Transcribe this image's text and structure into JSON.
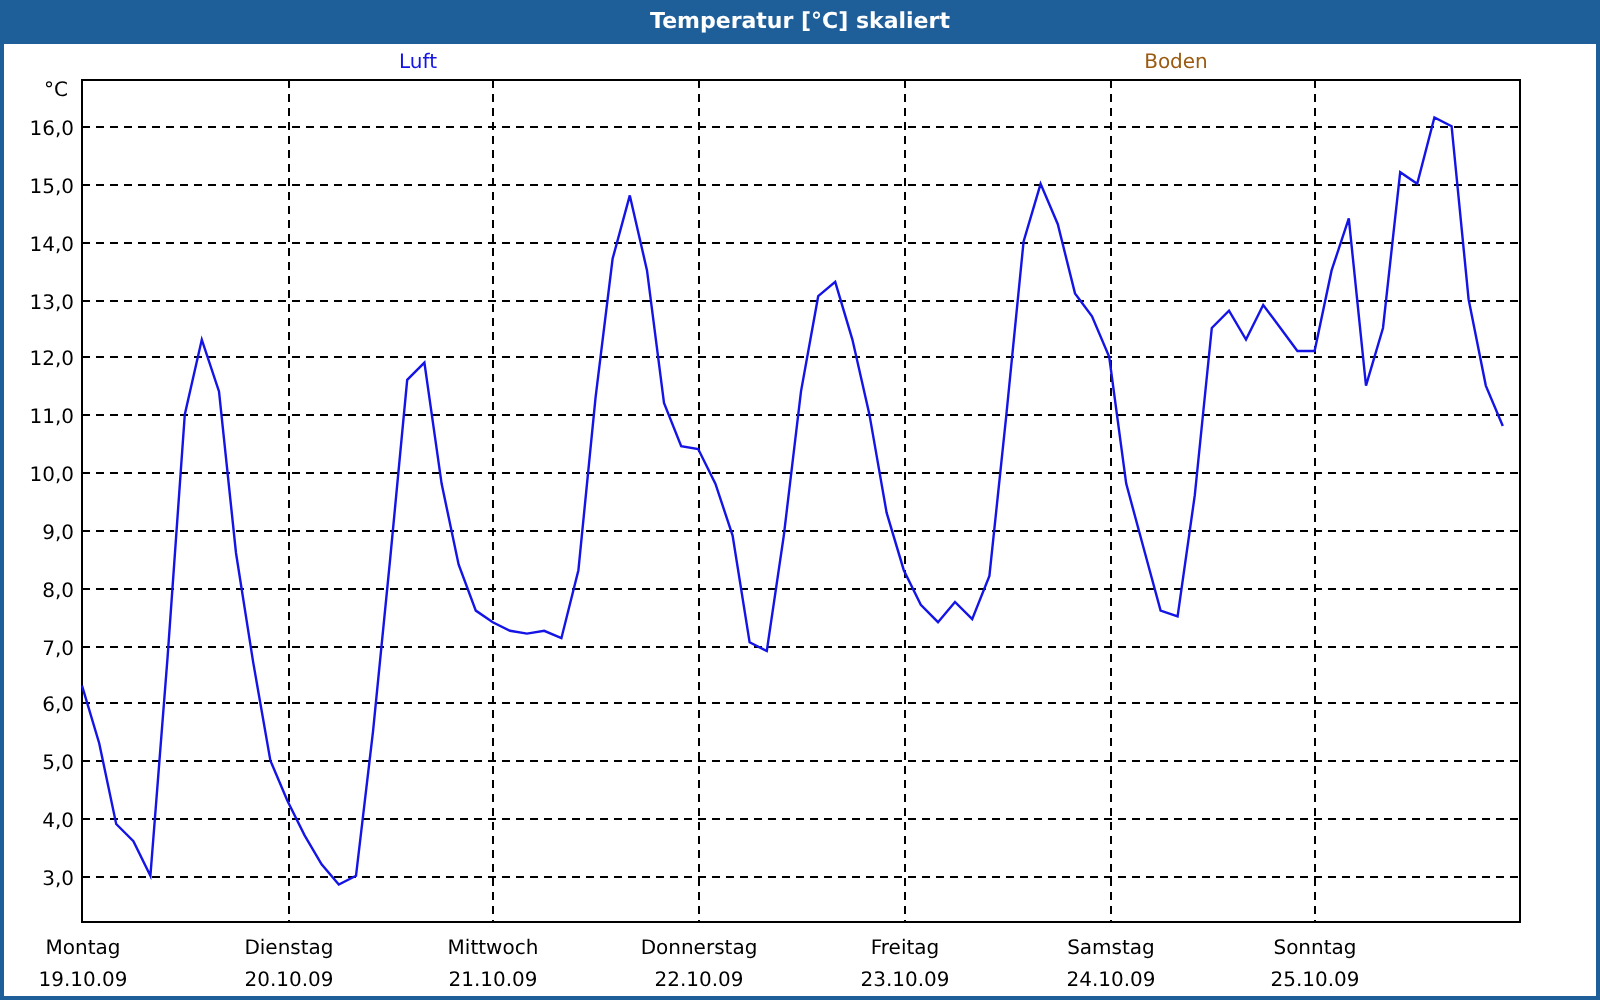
{
  "window": {
    "title": "Temperatur [°C] skaliert"
  },
  "legend": [
    {
      "label": "Boden",
      "color": "#9a5a10"
    }
  ],
  "chart_data": {
    "type": "line",
    "ylabel": "°C",
    "grid": true,
    "categories": [
      "Montag 19.10.09",
      null,
      null,
      null,
      null,
      null,
      null,
      null,
      null,
      null,
      null,
      null,
      "Dienstag 20.10.09",
      null,
      null,
      null,
      null,
      null,
      null,
      null,
      null,
      null,
      null,
      null,
      "Mittwoch 21.10.09",
      null,
      null,
      null,
      null,
      null,
      null,
      null,
      null,
      null,
      null,
      null,
      "Donnerstag 22.10.09",
      null,
      null,
      null,
      null,
      null,
      null,
      null,
      null,
      null,
      null,
      null,
      "Freitag 23.10.09",
      null,
      null,
      null,
      null,
      null,
      null,
      null,
      null,
      null,
      null,
      null,
      "Samstag 24.10.09",
      null,
      null,
      null,
      null,
      null,
      null,
      null,
      null,
      null,
      null,
      null,
      "Sonntag 25.10.09",
      null,
      null,
      null,
      null,
      null,
      null,
      null,
      null,
      null,
      null,
      null
    ],
    "series": [
      {
        "name": "Luft",
        "color": "#1414e6",
        "values": [
          6.3,
          5.3,
          3.9,
          3.6,
          3.0,
          6.8,
          11.0,
          12.3,
          11.4,
          8.6,
          6.7,
          5.0,
          4.3,
          3.7,
          3.2,
          2.85,
          3.0,
          5.5,
          8.5,
          11.6,
          11.9,
          9.8,
          8.4,
          7.6,
          7.4,
          7.25,
          7.2,
          7.25,
          7.12,
          8.3,
          11.3,
          13.7,
          14.8,
          13.5,
          11.2,
          10.45,
          10.4,
          9.8,
          8.9,
          7.05,
          6.9,
          8.9,
          11.4,
          13.05,
          13.3,
          12.3,
          11.0,
          9.3,
          8.3,
          7.7,
          7.4,
          7.75,
          7.45,
          8.2,
          11.0,
          14.0,
          15.0,
          14.3,
          13.1,
          12.7,
          12.0,
          9.8,
          8.7,
          7.6,
          7.5,
          9.6,
          12.5,
          12.8,
          12.3,
          12.9,
          12.5,
          12.1,
          12.1,
          13.5,
          14.4,
          11.5,
          12.5,
          15.2,
          15.0,
          16.15,
          16.0,
          13.0,
          11.5,
          10.8
        ]
      }
    ],
    "ylim": [
      2.2,
      16.8
    ],
    "yticks": [
      {
        "value": 3,
        "label": "3,0"
      },
      {
        "value": 4,
        "label": "4,0"
      },
      {
        "value": 5,
        "label": "5,0"
      },
      {
        "value": 6,
        "label": "6,0"
      },
      {
        "value": 7,
        "label": "7,0"
      },
      {
        "value": 8,
        "label": "8,0"
      },
      {
        "value": 9,
        "label": "9,0"
      },
      {
        "value": 10,
        "label": "10,0"
      },
      {
        "value": 11,
        "label": "11,0"
      },
      {
        "value": 12,
        "label": "12,0"
      },
      {
        "value": 13,
        "label": "13,0"
      },
      {
        "value": 14,
        "label": "14,0"
      },
      {
        "value": 15,
        "label": "15,0"
      },
      {
        "value": 16,
        "label": "16,0"
      }
    ]
  }
}
